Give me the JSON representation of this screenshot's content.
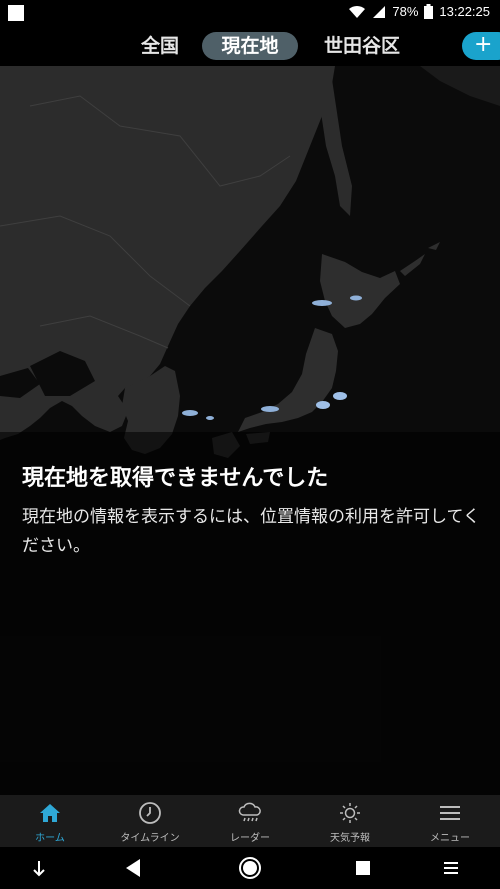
{
  "status": {
    "battery": "78%",
    "time": "13:22:25"
  },
  "tabs": [
    {
      "label": "全国",
      "active": false
    },
    {
      "label": "現在地",
      "active": true
    },
    {
      "label": "世田谷区",
      "active": false
    }
  ],
  "add_button": {
    "label": "+"
  },
  "message": {
    "title": "現在地を取得できませんでした",
    "body": "現在地の情報を表示するには、位置情報の利用を許可してください。"
  },
  "bottom_nav": [
    {
      "label": "ホーム",
      "icon": "home-icon",
      "active": true
    },
    {
      "label": "タイムライン",
      "icon": "clock-icon",
      "active": false
    },
    {
      "label": "レーダー",
      "icon": "rain-cloud-icon",
      "active": false
    },
    {
      "label": "天気予報",
      "icon": "sun-icon",
      "active": false
    },
    {
      "label": "メニュー",
      "icon": "menu-icon",
      "active": false
    }
  ],
  "colors": {
    "accent": "#1aa3cc",
    "active_tab": "#4f6068",
    "nav_active": "#2fa8d6"
  }
}
